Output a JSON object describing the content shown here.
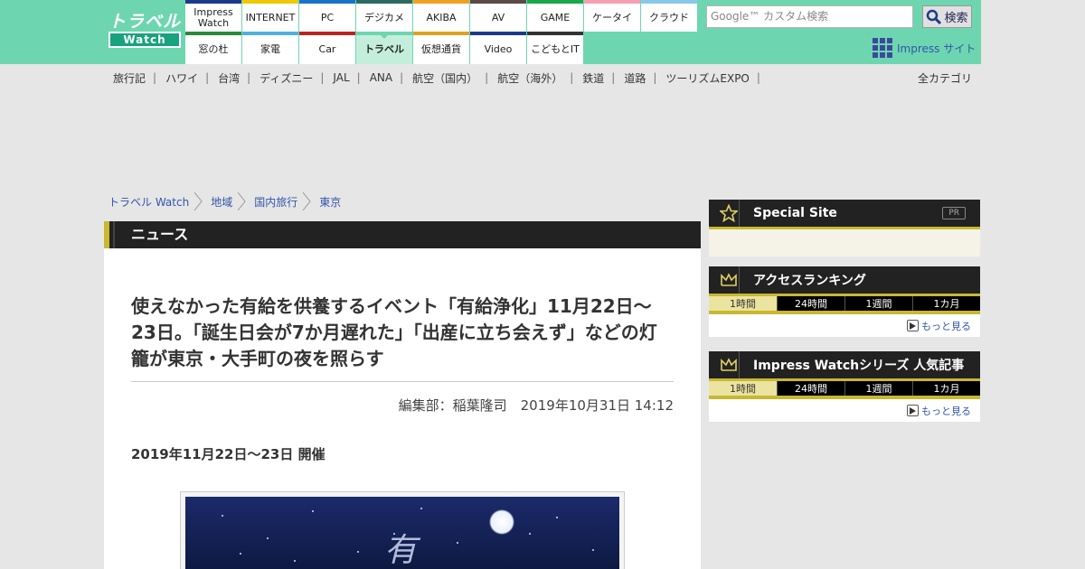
{
  "header": {
    "logo_top": "トラベル",
    "logo_bottom": "Watch",
    "nav": [
      {
        "label": "Impress\nWatch",
        "color": "#1b3a8a"
      },
      {
        "label": "INTERNET",
        "color": "#f0c800"
      },
      {
        "label": "PC",
        "color": "#1a73c8"
      },
      {
        "label": "デジカメ",
        "color": "#2a6a60"
      },
      {
        "label": "AKIBA",
        "color": "#f0a020"
      },
      {
        "label": "AV",
        "color": "#5a4a48"
      },
      {
        "label": "GAME",
        "color": "#18a84a"
      },
      {
        "label": "ケータイ",
        "color": "#f5a0b0"
      },
      {
        "label": "クラウド",
        "color": "#88c8e8"
      },
      {
        "label": "窓の杜",
        "color": "#2a8a3a"
      },
      {
        "label": "家電",
        "color": "#50b0e0"
      },
      {
        "label": "Car",
        "color": "#c02020"
      },
      {
        "label": "トラベル",
        "color": "#6dd6b0",
        "active": true
      },
      {
        "label": "仮想通貨",
        "color": "#e0a020"
      },
      {
        "label": "Video",
        "color": "#1b3a8a"
      },
      {
        "label": "こどもとIT",
        "color": "#333333"
      }
    ],
    "search_placeholder": "Google™ カスタム検索",
    "search_button": "検索",
    "impress_site": "Impress サイト"
  },
  "subnav": [
    "旅行記",
    "ハワイ",
    "台湾",
    "ディズニー",
    "JAL",
    "ANA",
    "航空（国内）",
    "航空（海外）",
    "鉄道",
    "道路",
    "ツーリズムEXPO"
  ],
  "all_categories": "全カテゴリ",
  "breadcrumb": [
    "トラベル Watch",
    "地域",
    "国内旅行",
    "東京"
  ],
  "article": {
    "section": "ニュース",
    "title": "使えなかった有給を供養するイベント「有給浄化」11月22日～23日。「誕生日会が7か月遅れた」「出産に立ち会えず」などの灯籠が東京・大手町の夜を照らす",
    "byline": "編集部：稲葉隆司　2019年10月31日 14:12",
    "event_date": "2019年11月22日～23日 開催"
  },
  "sidebar": {
    "special": {
      "title": "Special Site",
      "badge": "PR"
    },
    "ranking": {
      "title": "アクセスランキング",
      "tabs": [
        "1時間",
        "24時間",
        "1週間",
        "1カ月"
      ],
      "more": "もっと見る"
    },
    "series": {
      "title": "Impress Watchシリーズ 人気記事",
      "tabs": [
        "1時間",
        "24時間",
        "1週間",
        "1カ月"
      ],
      "more": "もっと見る"
    }
  }
}
